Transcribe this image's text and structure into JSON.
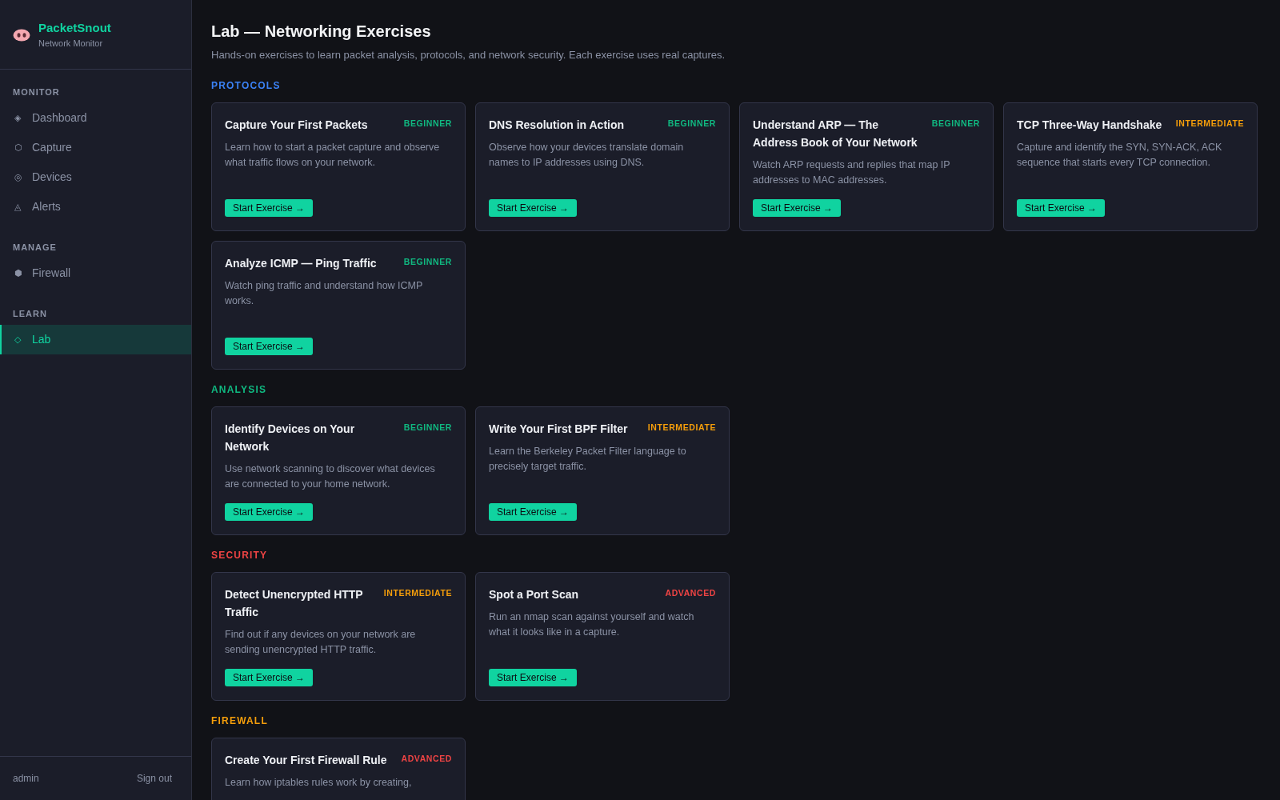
{
  "brand": {
    "name": "PacketSnout",
    "subtitle": "Network Monitor"
  },
  "sidebar": {
    "groups": [
      {
        "title": "MONITOR",
        "items": [
          {
            "icon": "◈",
            "label": "Dashboard",
            "selected": false
          },
          {
            "icon": "⬡",
            "label": "Capture",
            "selected": false
          },
          {
            "icon": "◎",
            "label": "Devices",
            "selected": false
          },
          {
            "icon": "◬",
            "label": "Alerts",
            "selected": false
          }
        ]
      },
      {
        "title": "MANAGE",
        "items": [
          {
            "icon": "⬢",
            "label": "Firewall",
            "selected": false
          }
        ]
      },
      {
        "title": "LEARN",
        "items": [
          {
            "icon": "◇",
            "label": "Lab",
            "selected": true
          }
        ]
      }
    ],
    "user": "admin",
    "sign_out": "Sign out"
  },
  "page": {
    "title": "Lab — Networking Exercises",
    "subtitle": "Hands-on exercises to learn packet analysis, protocols, and network security. Each exercise uses real captures."
  },
  "sections": [
    {
      "title": "PROTOCOLS",
      "color": "#3b82f6",
      "cards": [
        {
          "title": "Capture Your First Packets",
          "difficulty": "BEGINNER",
          "kind": "beginner",
          "description": "Learn how to start a packet capture and observe what traffic flows on your network.",
          "button": "Start Exercise →"
        },
        {
          "title": "DNS Resolution in Action",
          "difficulty": "BEGINNER",
          "kind": "beginner",
          "description": "Observe how your devices translate domain names to IP addresses using DNS.",
          "button": "Start Exercise →"
        },
        {
          "title": "Understand ARP — The Address Book of Your Network",
          "difficulty": "BEGINNER",
          "kind": "beginner",
          "description": "Watch ARP requests and replies that map IP addresses to MAC addresses.",
          "button": "Start Exercise →"
        },
        {
          "title": "TCP Three-Way Handshake",
          "difficulty": "INTERMEDIATE",
          "kind": "intermediate",
          "description": "Capture and identify the SYN, SYN-ACK, ACK sequence that starts every TCP connection.",
          "button": "Start Exercise →"
        },
        {
          "title": "Analyze ICMP — Ping Traffic",
          "difficulty": "BEGINNER",
          "kind": "beginner",
          "description": "Watch ping traffic and understand how ICMP works.",
          "button": "Start Exercise →"
        }
      ]
    },
    {
      "title": "ANALYSIS",
      "color": "#10b981",
      "cards": [
        {
          "title": "Identify Devices on Your Network",
          "difficulty": "BEGINNER",
          "kind": "beginner",
          "description": "Use network scanning to discover what devices are connected to your home network.",
          "button": "Start Exercise →"
        },
        {
          "title": "Write Your First BPF Filter",
          "difficulty": "INTERMEDIATE",
          "kind": "intermediate",
          "description": "Learn the Berkeley Packet Filter language to precisely target traffic.",
          "button": "Start Exercise →"
        }
      ]
    },
    {
      "title": "SECURITY",
      "color": "#ef4444",
      "cards": [
        {
          "title": "Detect Unencrypted HTTP Traffic",
          "difficulty": "INTERMEDIATE",
          "kind": "intermediate",
          "description": "Find out if any devices on your network are sending unencrypted HTTP traffic.",
          "button": "Start Exercise →"
        },
        {
          "title": "Spot a Port Scan",
          "difficulty": "ADVANCED",
          "kind": "advanced",
          "description": "Run an nmap scan against yourself and watch what it looks like in a capture.",
          "button": "Start Exercise →"
        }
      ]
    },
    {
      "title": "FIREWALL",
      "color": "#f59e0b",
      "cards": [
        {
          "title": "Create Your First Firewall Rule",
          "difficulty": "ADVANCED",
          "kind": "advanced",
          "description": "Learn how iptables rules work by creating,"
        }
      ]
    }
  ]
}
